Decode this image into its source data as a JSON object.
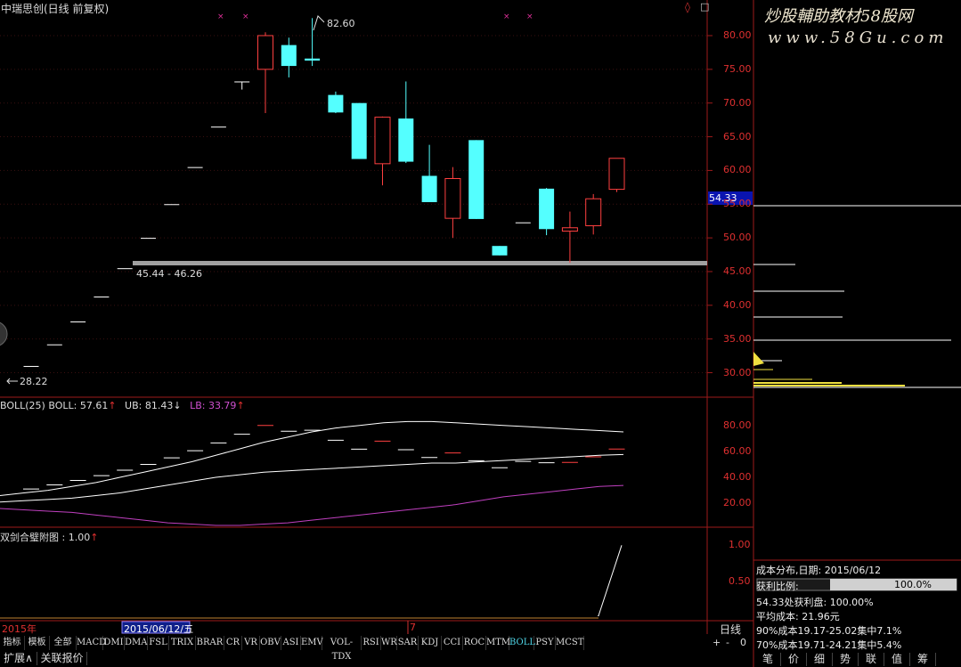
{
  "window": {
    "title": "中瑞思创(日线 前复权)"
  },
  "watermark": {
    "line1": "炒股輔助教材58股网",
    "line2": "www.58Gu.com"
  },
  "main_panel": {
    "high_label": "82.60",
    "low_label": "28.22",
    "range_label": "45.44 - 46.26",
    "current_price": "54.33",
    "y_ticks": [
      "80.00",
      "75.00",
      "70.00",
      "65.00",
      "60.00",
      "55.00",
      "50.00",
      "45.00",
      "40.00",
      "35.00",
      "30.00"
    ]
  },
  "boll_panel": {
    "name": "BOLL(25)",
    "boll_label": "BOLL: 57.61",
    "ub_label": "UB: 81.43",
    "lb_label": "LB: 33.79",
    "y_ticks": [
      "80.00",
      "60.00",
      "40.00",
      "20.00"
    ]
  },
  "sub_panel": {
    "title": "双剑合璧附图 : 1.00",
    "y_ticks": [
      "1.00",
      "0.50"
    ]
  },
  "time_axis": {
    "year_label": "2015年",
    "cursor_date": "2015/06/12/五",
    "month_label": "7",
    "period_label": "日线"
  },
  "tabs": [
    "指标",
    "模板",
    "全部",
    "MACD",
    "DMI",
    "DMA",
    "FSL",
    "TRIX",
    "BRAR",
    "CR",
    "VR",
    "OBV",
    "ASI",
    "EMV",
    "VOL-TDX",
    "RSI",
    "WR",
    "SAR",
    "KDJ",
    "CCI",
    "ROC",
    "MTM",
    "BOLL",
    "PSY",
    "MCST"
  ],
  "active_tab": "BOLL",
  "bottom_buttons": {
    "expand": "扩展∧",
    "related_quote": "关联报价"
  },
  "zoom_controls": [
    "+",
    "-",
    "0"
  ],
  "cost_distribution": {
    "title": "成本分布,日期: 2015/06/12",
    "profit_ratio_label": "获利比例:",
    "profit_ratio_value": "100.0%",
    "profit_at_price": "54.33处获利盘: 100.00%",
    "avg_cost": "平均成本: 21.96元",
    "cost_90": "90%成本19.17-25.02集中7.1%",
    "cost_70": "70%成本19.71-24.21集中5.4%"
  },
  "right_tabs": [
    "笔",
    "价",
    "细",
    "势",
    "联",
    "值",
    "筹"
  ],
  "chart_data": {
    "type": "candlestick",
    "price_ylim": [
      25.5,
      83.5
    ],
    "candles": [
      {
        "o": 31.0,
        "c": 31.0,
        "h": 31.0,
        "l": 31.0
      },
      {
        "o": 34.2,
        "c": 34.2,
        "h": 34.2,
        "l": 34.2
      },
      {
        "o": 37.6,
        "c": 37.6,
        "h": 37.6,
        "l": 37.6
      },
      {
        "o": 41.3,
        "c": 41.3,
        "h": 41.3,
        "l": 41.3
      },
      {
        "o": 45.5,
        "c": 45.5,
        "h": 45.5,
        "l": 45.5
      },
      {
        "o": 50.0,
        "c": 50.0,
        "h": 50.0,
        "l": 50.0
      },
      {
        "o": 55.0,
        "c": 55.0,
        "h": 55.0,
        "l": 55.0
      },
      {
        "o": 60.5,
        "c": 60.5,
        "h": 60.5,
        "l": 60.5
      },
      {
        "o": 66.5,
        "c": 66.5,
        "h": 66.5,
        "l": 66.5
      },
      {
        "o": 73.2,
        "c": 73.2,
        "h": 73.2,
        "l": 72.0
      },
      {
        "o": 75.0,
        "c": 80.0,
        "h": 80.5,
        "l": 68.5
      },
      {
        "o": 78.6,
        "c": 75.5,
        "h": 79.7,
        "l": 73.8
      },
      {
        "o": 76.6,
        "c": 76.3,
        "h": 82.6,
        "l": 75.5
      },
      {
        "o": 71.2,
        "c": 68.6,
        "h": 71.7,
        "l": 68.5
      },
      {
        "o": 70.0,
        "c": 61.7,
        "h": 70.0,
        "l": 61.7
      },
      {
        "o": 61.0,
        "c": 67.9,
        "h": 68.0,
        "l": 57.8
      },
      {
        "o": 67.7,
        "c": 61.3,
        "h": 73.2,
        "l": 61.1
      },
      {
        "o": 59.2,
        "c": 55.3,
        "h": 63.8,
        "l": 55.3
      },
      {
        "o": 52.9,
        "c": 58.8,
        "h": 60.5,
        "l": 50.0
      },
      {
        "o": 64.5,
        "c": 52.8,
        "h": 64.5,
        "l": 52.8
      },
      {
        "o": 48.8,
        "c": 47.4,
        "h": 48.8,
        "l": 47.4
      },
      {
        "o": 52.3,
        "c": 52.3,
        "h": 52.3,
        "l": 52.3
      },
      {
        "o": 57.3,
        "c": 51.3,
        "h": 57.4,
        "l": 50.4
      },
      {
        "o": 51.0,
        "c": 51.5,
        "h": 53.9,
        "l": 46.3
      },
      {
        "o": 51.8,
        "c": 55.8,
        "h": 56.5,
        "l": 50.5
      },
      {
        "o": 57.2,
        "c": 61.8,
        "h": 61.8,
        "l": 56.8
      }
    ],
    "boll_ylim": [
      3,
      99
    ],
    "boll_mid": [
      26,
      28,
      30,
      33,
      36,
      40,
      44,
      48,
      52,
      57,
      62,
      67,
      71,
      75,
      78,
      80,
      82,
      83,
      83,
      82,
      81,
      80,
      79,
      78,
      77,
      76,
      75
    ],
    "boll_lower": [
      21,
      22,
      23,
      24,
      26,
      28,
      31,
      34,
      37,
      40,
      42,
      44,
      45,
      46,
      47,
      48,
      49,
      50,
      51,
      51,
      52,
      53,
      54,
      55,
      56,
      57,
      57.6
    ],
    "boll_lb": [
      16,
      15,
      14,
      13,
      11,
      9,
      7,
      5,
      4,
      3,
      3,
      4,
      5,
      7,
      9,
      11,
      13,
      15,
      17,
      19,
      22,
      25,
      27,
      29,
      31,
      33,
      33.8
    ],
    "sub_ylim": [
      0,
      1.2
    ],
    "sub_line": [
      0.03,
      0.03,
      0.03,
      0.03,
      0.03,
      0.03,
      0.03,
      0.03,
      0.03,
      0.03,
      0.03,
      0.03,
      0.03,
      0.03,
      0.03,
      0.03,
      0.03,
      0.03,
      0.03,
      0.03,
      0.03,
      0.03,
      0.03,
      0.03,
      0.03,
      0.03,
      1.0
    ]
  }
}
